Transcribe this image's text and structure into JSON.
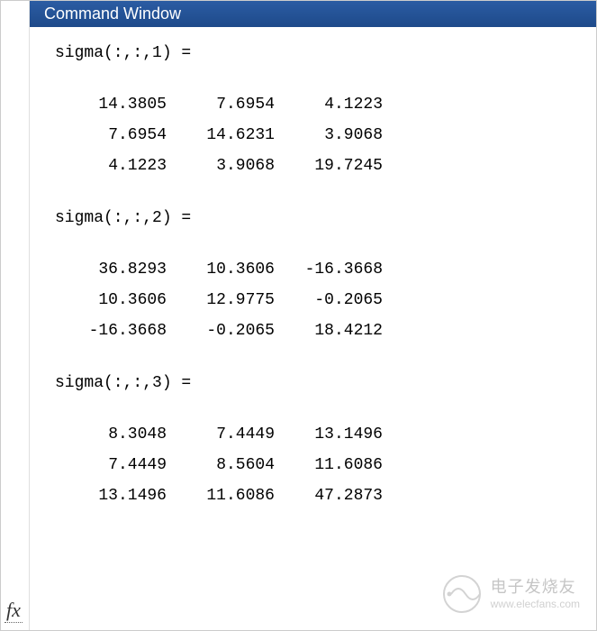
{
  "window": {
    "title": "Command Window"
  },
  "output": {
    "blocks": [
      {
        "header": "sigma(:,:,1) =",
        "rows": [
          [
            "14.3805",
            "7.6954",
            "4.1223"
          ],
          [
            "7.6954",
            "14.6231",
            "3.9068"
          ],
          [
            "4.1223",
            "3.9068",
            "19.7245"
          ]
        ]
      },
      {
        "header": "sigma(:,:,2) =",
        "rows": [
          [
            "36.8293",
            "10.3606",
            "-16.3668"
          ],
          [
            "10.3606",
            "12.9775",
            "-0.2065"
          ],
          [
            "-16.3668",
            "-0.2065",
            "18.4212"
          ]
        ]
      },
      {
        "header": "sigma(:,:,3) =",
        "rows": [
          [
            "8.3048",
            "7.4449",
            "13.1496"
          ],
          [
            "7.4449",
            "8.5604",
            "11.6086"
          ],
          [
            "13.1496",
            "11.6086",
            "47.2873"
          ]
        ]
      }
    ]
  },
  "prompt": {
    "fx_label": "fx"
  },
  "watermark": {
    "main": "电子发烧友",
    "sub": "www.elecfans.com"
  }
}
